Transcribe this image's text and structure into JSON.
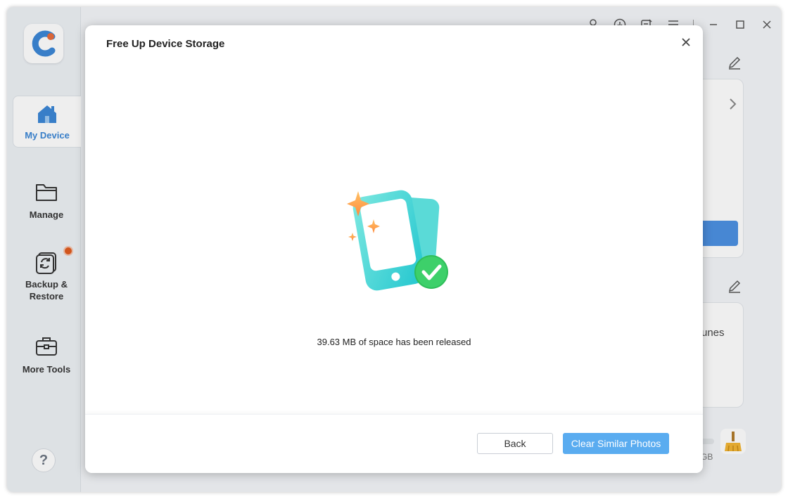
{
  "sidebar": {
    "items": [
      {
        "label": "My Device",
        "icon": "home-icon",
        "active": true
      },
      {
        "label": "Manage",
        "icon": "folder-icon"
      },
      {
        "label": "Backup & Restore",
        "icon": "backup-restore-icon",
        "has_badge": true
      },
      {
        "label": "More Tools",
        "icon": "toolbox-icon"
      }
    ],
    "help_label": "?"
  },
  "background": {
    "partial_text_1": "unes",
    "partial_text_2": "GB"
  },
  "modal": {
    "title": "Free Up Device Storage",
    "status": "39.63 MB of space has been released",
    "back_label": "Back",
    "primary_label": "Clear Similar Photos"
  },
  "colors": {
    "accent": "#3a86d6",
    "primary_button": "#5aacf0",
    "success": "#2ecc71",
    "badge": "#e05a1c"
  }
}
